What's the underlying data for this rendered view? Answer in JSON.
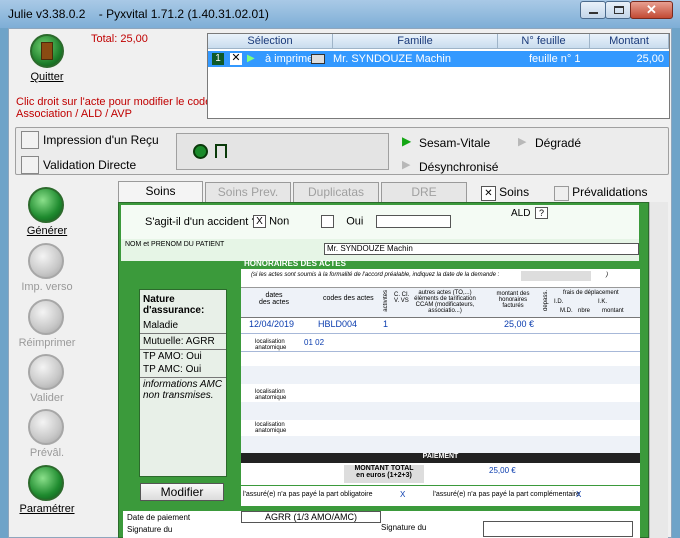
{
  "window": {
    "title_left": "Julie v3.38.0.2",
    "title_right": "- Pyxvital 1.71.2 (1.40.31.02.01)"
  },
  "top": {
    "quit_label": "Quitter",
    "total": "Total: 25,00",
    "hint_line1": "Clic droit sur l'acte pour modifier le code",
    "hint_line2": "Association / ALD / AVP"
  },
  "grid": {
    "headers": [
      "Sélection",
      "Famille",
      "N° feuille",
      "Montant"
    ],
    "row": {
      "num": "1",
      "status": "à imprimer",
      "famille": "Mr. SYNDOUZE Machin",
      "feuille": "feuille n° 1",
      "montant": "25,00"
    }
  },
  "toolbar": {
    "print_receipt": "Impression d'un Reçu",
    "validate_direct": "Validation Directe",
    "sesam": "Sesam-Vitale",
    "degrade": "Dégradé",
    "desync": "Désynchronisé"
  },
  "sidebar": [
    {
      "label": "Générer",
      "enabled": true
    },
    {
      "label": "Imp. verso",
      "enabled": false
    },
    {
      "label": "Réimprimer",
      "enabled": false
    },
    {
      "label": "Valider",
      "enabled": false
    },
    {
      "label": "Prévâl.",
      "enabled": false
    },
    {
      "label": "Paramétrer",
      "enabled": true
    }
  ],
  "tabs": [
    "Soins",
    "Soins Prev.",
    "Duplicatas",
    "DRE"
  ],
  "tab_checks": {
    "soins": "Soins",
    "soins_checked": true,
    "prevalidations": "Prévalidations",
    "prevalidations_checked": false
  },
  "form": {
    "accident_q": "S'agit-il d'un accident ?",
    "non": "Non",
    "oui": "Oui",
    "ald": "ALD",
    "ald_value": "?",
    "nom_label": "NOM et PRENOM DU PATIENT",
    "nom_value": "Mr. SYNDOUZE Machin",
    "honoraires": "HONORAIRES DES ACTES",
    "note": "(si les actes sont soumis à la formalité de l'accord préalable, indiquez la date de la demande :",
    "note_end": ")",
    "col_dates": "dates des actes",
    "col_codes": "codes des actes",
    "col_activites": "activités",
    "col_cci": "C. CI. V. VS",
    "col_autres": "autres actes (TO,...) éléments de tarification CCAM (modificateurs, associatio...)",
    "col_montant": "montant des honoraires facturés",
    "col_depass": "dépass.",
    "col_frais": "frais de déplacement",
    "col_id": "I.D.",
    "col_md": "M.D.",
    "col_nbre": "nbre",
    "col_ik": "I.K.",
    "col_ik_montant": "montant",
    "act_date": "12/04/2019",
    "act_code": "HBLD004",
    "act_activite": "1",
    "act_montant": "25,00 €",
    "loc_label": "localisation anatomique",
    "loc_value": "01 02",
    "paiement": "PAIEMENT",
    "montant_total": "MONTANT TOTAL",
    "en_euros": "en euros (1+2+3)",
    "total_value": "25,00 €",
    "assure_oblig": "l'assuré(e) n'a pas payé la part obligatoire",
    "assure_oblig_x": "X",
    "assure_compl": "l'assuré(e) n'a pas payé la part complémentaire",
    "assure_compl_x": "X",
    "date_paiement": "Date de paiement",
    "signature_du": "Signature du",
    "payment_mode": "AGRR (1/3 AMO/AMC)",
    "signature_du2": "Signature du"
  },
  "insurance": {
    "nature_label": "Nature d'assurance:",
    "nature_value": "Maladie",
    "mutuelle": "Mutuelle: AGRR",
    "tp_amo": "TP AMO: Oui",
    "tp_amc": "TP AMC: Oui",
    "info": "informations AMC non transmises.",
    "modifier": "Modifier"
  }
}
